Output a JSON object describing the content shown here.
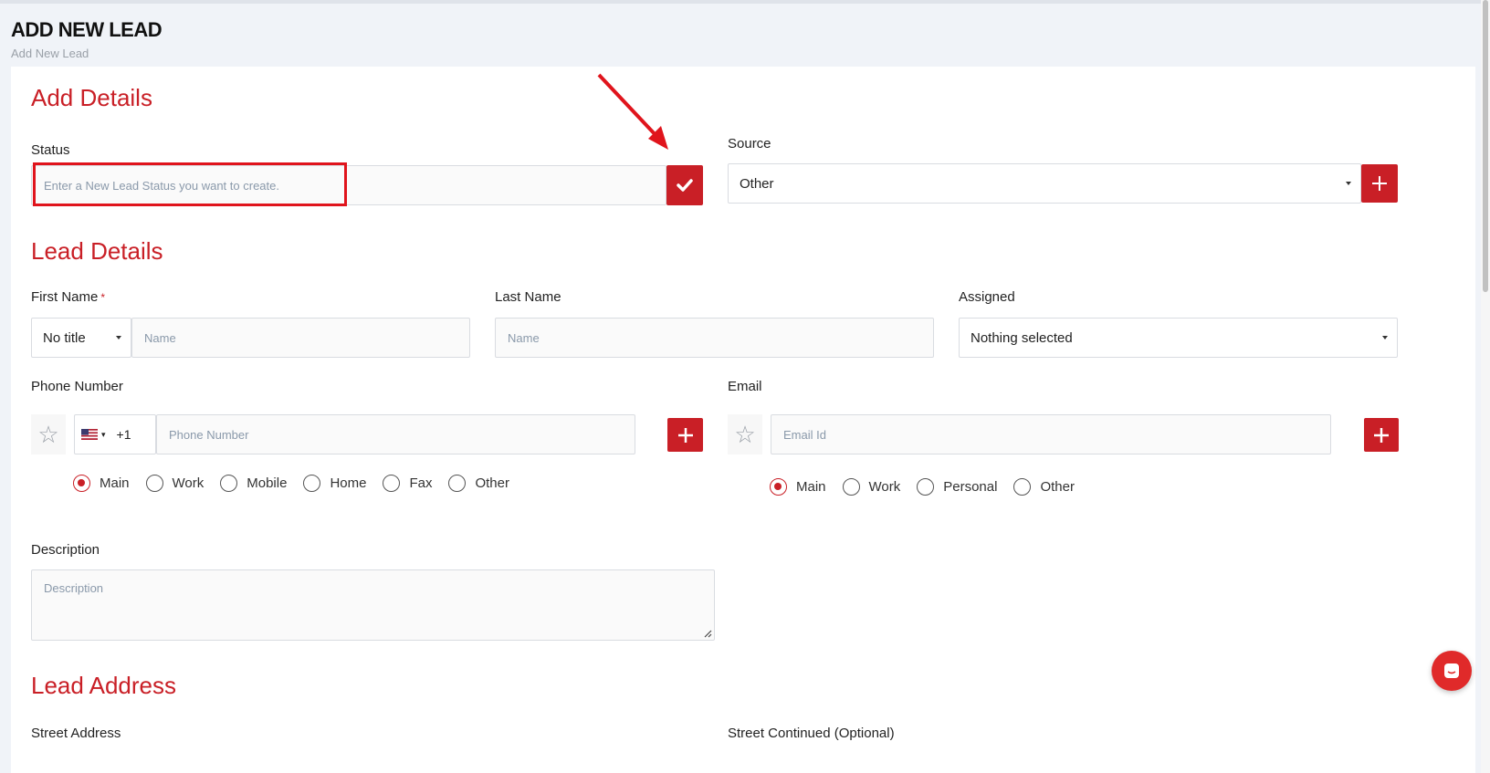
{
  "header": {
    "title": "ADD NEW LEAD",
    "breadcrumb": "Add New Lead"
  },
  "sections": {
    "add_details": "Add Details",
    "lead_details": "Lead Details",
    "lead_address": "Lead Address"
  },
  "status": {
    "label": "Status",
    "placeholder": "Enter a New Lead Status you want to create."
  },
  "source": {
    "label": "Source",
    "selected": "Other"
  },
  "first_name": {
    "label": "First Name",
    "required_mark": "*",
    "title_selected": "No title",
    "placeholder": "Name"
  },
  "last_name": {
    "label": "Last Name",
    "placeholder": "Name"
  },
  "assigned": {
    "label": "Assigned",
    "selected": "Nothing selected"
  },
  "phone": {
    "label": "Phone Number",
    "country_code": "+1",
    "placeholder": "Phone Number",
    "types": [
      "Main",
      "Work",
      "Mobile",
      "Home",
      "Fax",
      "Other"
    ],
    "selected": "Main"
  },
  "email": {
    "label": "Email",
    "placeholder": "Email Id",
    "types": [
      "Main",
      "Work",
      "Personal",
      "Other"
    ],
    "selected": "Main"
  },
  "description": {
    "label": "Description",
    "placeholder": "Description"
  },
  "address": {
    "street_label": "Street Address",
    "street2_label": "Street Continued (Optional)"
  },
  "colors": {
    "accent": "#c91f26",
    "annotation": "#e0141c"
  },
  "icons": {
    "confirm": "check-icon",
    "add": "plus-icon",
    "favorite": "star-icon",
    "chat": "chat-icon",
    "annotation": "arrow-annotation"
  }
}
